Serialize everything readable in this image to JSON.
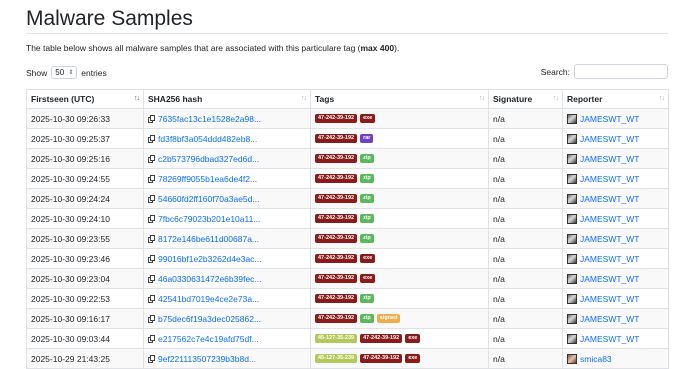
{
  "page": {
    "title": "Malware Samples",
    "desc_before": "The table below shows all malware samples that are associated with this particulare tag (",
    "desc_bold": "max 400",
    "desc_after": ")."
  },
  "controls": {
    "show_label": "Show",
    "entries_value": "50",
    "entries_label": "entries",
    "search_label": "Search:",
    "search_value": ""
  },
  "table": {
    "headers": [
      "Firstseen (UTC)",
      "SHA256 hash",
      "Tags",
      "Signature",
      "Reporter"
    ],
    "rows": [
      {
        "firstseen": "2025-10-30 09:26:33",
        "hash": "7635fac13c1e1528e2a98...",
        "tags": [
          {
            "label": "47-242-39-192",
            "color": "#8b1a1a"
          },
          {
            "label": "exe",
            "color": "#8b1a1a"
          }
        ],
        "signature": "n/a",
        "reporter": "JAMESWT_WT",
        "avatar": "default"
      },
      {
        "firstseen": "2025-10-30 09:25:37",
        "hash": "fd3f8bf3a054ddd482eb8...",
        "tags": [
          {
            "label": "47-242-39-192",
            "color": "#8b1a1a"
          },
          {
            "label": "rar",
            "color": "#6f42c1"
          }
        ],
        "signature": "n/a",
        "reporter": "JAMESWT_WT",
        "avatar": "default"
      },
      {
        "firstseen": "2025-10-30 09:25:16",
        "hash": "c2b573796dbad327ed6d...",
        "tags": [
          {
            "label": "47-242-39-192",
            "color": "#8b1a1a"
          },
          {
            "label": "zip",
            "color": "#5cb85c"
          }
        ],
        "signature": "n/a",
        "reporter": "JAMESWT_WT",
        "avatar": "default"
      },
      {
        "firstseen": "2025-10-30 09:24:55",
        "hash": "78269ff9055b1ea6de4f2...",
        "tags": [
          {
            "label": "47-242-39-192",
            "color": "#8b1a1a"
          },
          {
            "label": "zip",
            "color": "#5cb85c"
          }
        ],
        "signature": "n/a",
        "reporter": "JAMESWT_WT",
        "avatar": "default"
      },
      {
        "firstseen": "2025-10-30 09:24:24",
        "hash": "54660fd2ff160f70a3ae5d...",
        "tags": [
          {
            "label": "47-242-39-192",
            "color": "#8b1a1a"
          },
          {
            "label": "zip",
            "color": "#5cb85c"
          }
        ],
        "signature": "n/a",
        "reporter": "JAMESWT_WT",
        "avatar": "default"
      },
      {
        "firstseen": "2025-10-30 09:24:10",
        "hash": "7fbc6c79023b201e10a11...",
        "tags": [
          {
            "label": "47-242-39-192",
            "color": "#8b1a1a"
          },
          {
            "label": "zip",
            "color": "#5cb85c"
          }
        ],
        "signature": "n/a",
        "reporter": "JAMESWT_WT",
        "avatar": "default"
      },
      {
        "firstseen": "2025-10-30 09:23:55",
        "hash": "8172e146be611d00687a...",
        "tags": [
          {
            "label": "47-242-39-192",
            "color": "#8b1a1a"
          },
          {
            "label": "zip",
            "color": "#5cb85c"
          }
        ],
        "signature": "n/a",
        "reporter": "JAMESWT_WT",
        "avatar": "default"
      },
      {
        "firstseen": "2025-10-30 09:23:46",
        "hash": "99016bf1e2b3262d4e3ac...",
        "tags": [
          {
            "label": "47-242-39-192",
            "color": "#8b1a1a"
          },
          {
            "label": "exe",
            "color": "#8b1a1a"
          }
        ],
        "signature": "n/a",
        "reporter": "JAMESWT_WT",
        "avatar": "default"
      },
      {
        "firstseen": "2025-10-30 09:23:04",
        "hash": "46a0330631472e6b39fec...",
        "tags": [
          {
            "label": "47-242-39-192",
            "color": "#8b1a1a"
          },
          {
            "label": "exe",
            "color": "#8b1a1a"
          }
        ],
        "signature": "n/a",
        "reporter": "JAMESWT_WT",
        "avatar": "default"
      },
      {
        "firstseen": "2025-10-30 09:22:53",
        "hash": "42541bd7019e4ce2e73a...",
        "tags": [
          {
            "label": "47-242-39-192",
            "color": "#8b1a1a"
          },
          {
            "label": "zip",
            "color": "#5cb85c"
          }
        ],
        "signature": "n/a",
        "reporter": "JAMESWT_WT",
        "avatar": "default"
      },
      {
        "firstseen": "2025-10-30 09:16:17",
        "hash": "b75dec6f19a3dec025862...",
        "tags": [
          {
            "label": "47-242-39-192",
            "color": "#8b1a1a"
          },
          {
            "label": "zip",
            "color": "#5cb85c"
          },
          {
            "label": "signed",
            "color": "#f0ad4e"
          }
        ],
        "signature": "n/a",
        "reporter": "JAMESWT_WT",
        "avatar": "default"
      },
      {
        "firstseen": "2025-10-30 09:03:44",
        "hash": "e217562c7e4c19afd75df...",
        "tags": [
          {
            "label": "45-127-35-239",
            "color": "#b5c95a"
          },
          {
            "label": "47-242-39-192",
            "color": "#8b1a1a"
          },
          {
            "label": "exe",
            "color": "#8b1a1a"
          }
        ],
        "signature": "n/a",
        "reporter": "JAMESWT_WT",
        "avatar": "default"
      },
      {
        "firstseen": "2025-10-29 21:43:25",
        "hash": "9ef221113507239b3b8d...",
        "tags": [
          {
            "label": "45-127-35-239",
            "color": "#b5c95a"
          },
          {
            "label": "47-242-39-192",
            "color": "#8b1a1a"
          },
          {
            "label": "exe",
            "color": "#8b1a1a"
          }
        ],
        "signature": "n/a",
        "reporter": "smica83",
        "avatar": "alt"
      }
    ]
  }
}
